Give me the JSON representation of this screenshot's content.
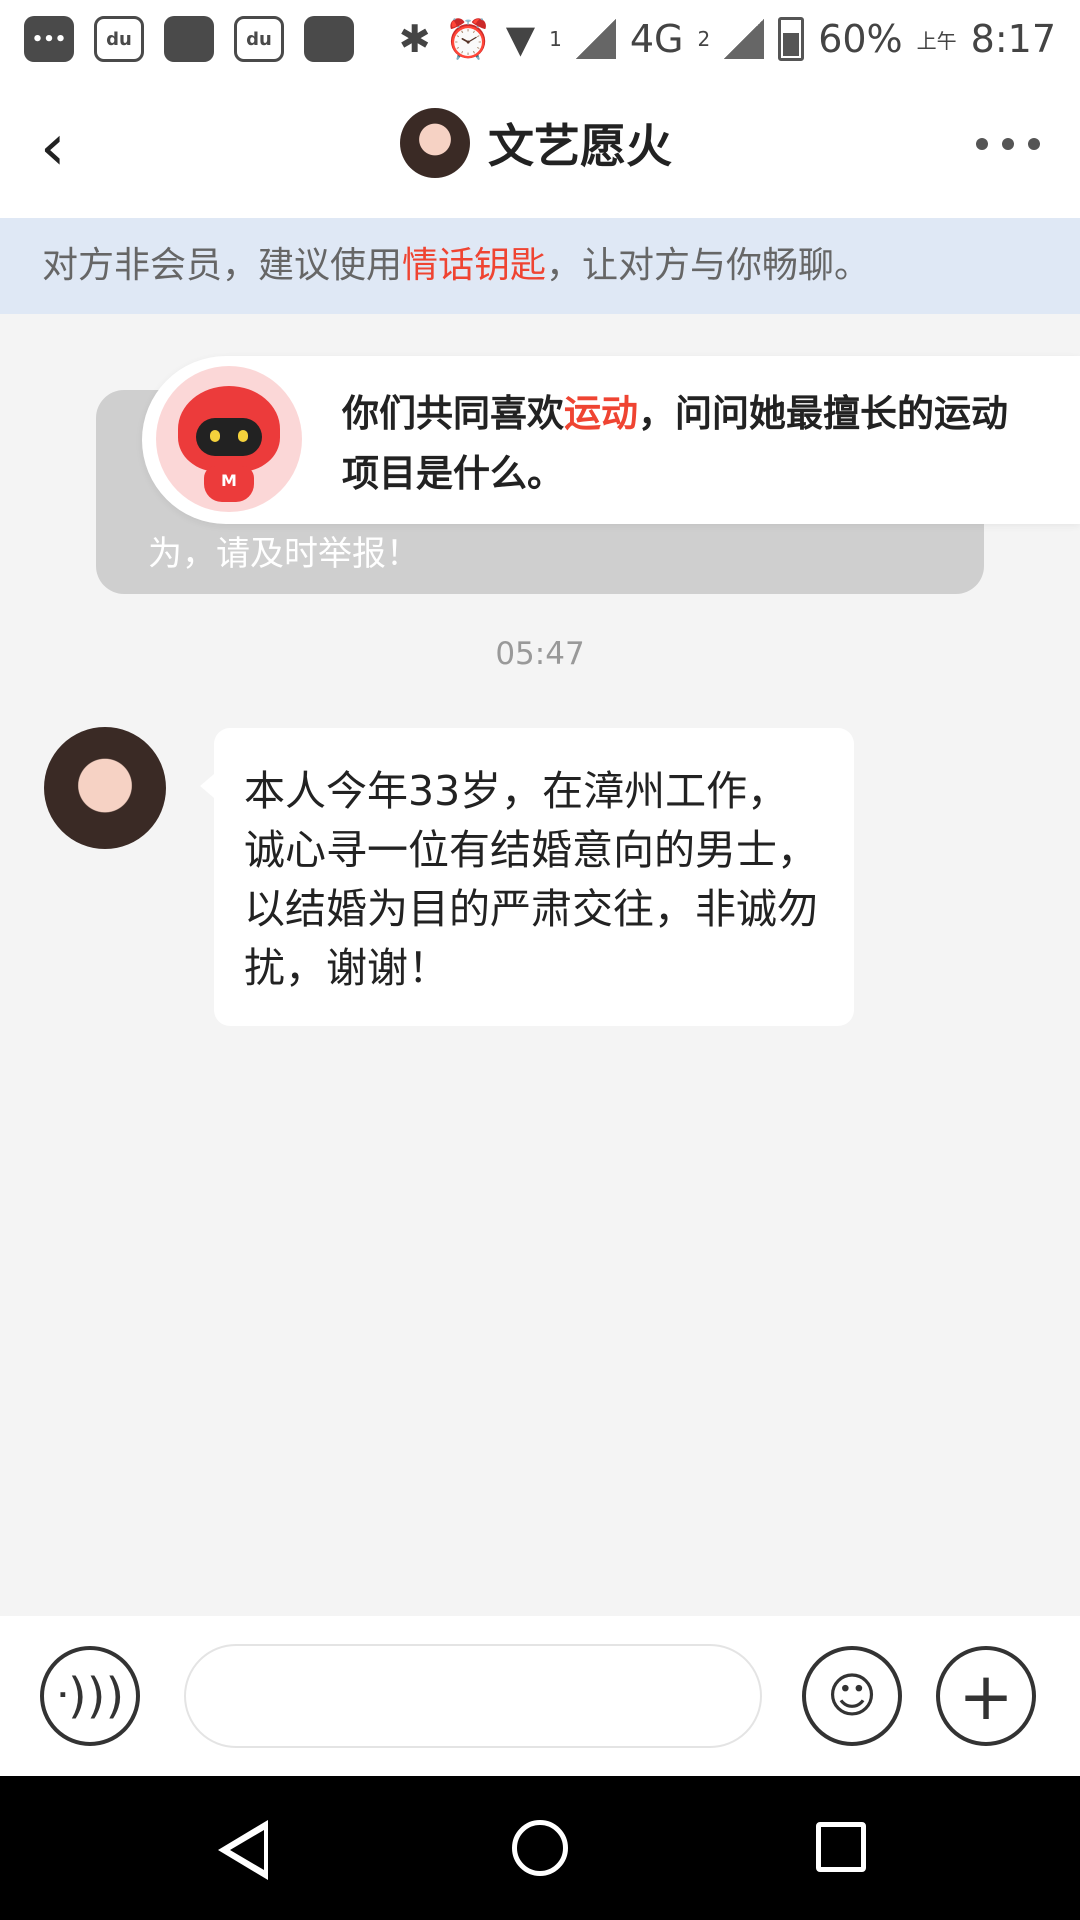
{
  "status_bar": {
    "app_icon_labels": [
      "•••",
      "du",
      "",
      "du",
      ""
    ],
    "network_a": "1",
    "network_b": "4G",
    "network_b_sub": "2",
    "battery": "60%",
    "am_pm": "上午",
    "time": "8:17"
  },
  "header": {
    "title": "文艺愿火"
  },
  "banner": {
    "prefix": "对方非会员，建议使用",
    "highlight": "情话钥匙",
    "suffix": "，让对方与你畅聊。"
  },
  "notice": {
    "partial_text": "为，请及时举报！"
  },
  "tip": {
    "mascot_letter": "M",
    "line1_prefix": "你们共同喜欢",
    "line1_highlight": "运动",
    "line1_suffix": "，问问她最擅长的运动",
    "line2": "项目是什么。"
  },
  "chat": {
    "time": "05:47",
    "message": "本人今年33岁，在漳州工作，诚心寻一位有结婚意向的男士，以结婚为目的严肃交往，非诚勿扰，谢谢！"
  },
  "icons": {
    "back": "back-arrow-icon",
    "more": "more-dots-icon",
    "voice": "voice-icon",
    "emoji": "emoji-icon",
    "plus": "plus-icon"
  },
  "colors": {
    "accent_red": "#ef4432",
    "banner_bg": "#dfe8f5"
  }
}
